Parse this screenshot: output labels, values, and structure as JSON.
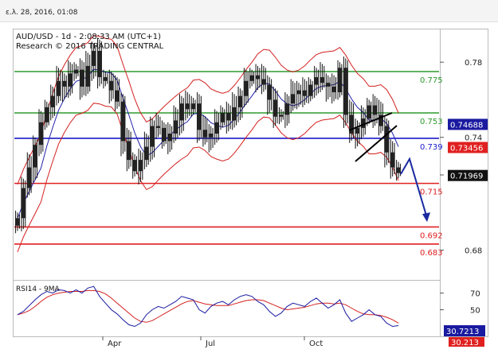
{
  "header": {
    "timestamp": "ε.λ. 28, 2016, 01:08"
  },
  "chart_data": {
    "type": "candlestick",
    "title": "AUD/USD - 1d - 2:08:33 AM (UTC+1)",
    "subtitle": "Research © 2016 TRADING CENTRAL",
    "x_labels": [
      "Apr",
      "Jul",
      "Oct"
    ],
    "y_axis": {
      "range": [
        0.665,
        0.797
      ],
      "ticks": [
        "0.78",
        "0.74",
        "0.72",
        "0.68"
      ]
    },
    "levels": [
      {
        "label": "0.775",
        "value": 0.775,
        "color": "#2f9a2f"
      },
      {
        "label": "0.753",
        "value": 0.753,
        "color": "#2f9a2f"
      },
      {
        "label": "0.739",
        "value": 0.7395,
        "color": "#1a1acc"
      },
      {
        "label": "0.715",
        "value": 0.7155,
        "color": "#e02020"
      },
      {
        "label": "0.692",
        "value": 0.6923,
        "color": "#e02020"
      },
      {
        "label": "0.683",
        "value": 0.6832,
        "color": "#e02020"
      }
    ],
    "price_boxes": [
      {
        "label": "0.74688",
        "value": 0.7469,
        "bg": "#1a1aa0"
      },
      {
        "label": "0.73456",
        "value": 0.7346,
        "bg": "#e02020"
      },
      {
        "label": "0.71969",
        "value": 0.7197,
        "bg": "#111111"
      }
    ],
    "price_series": [
      0.697,
      0.713,
      0.724,
      0.736,
      0.748,
      0.756,
      0.762,
      0.77,
      0.767,
      0.774,
      0.776,
      0.767,
      0.778,
      0.786,
      0.772,
      0.77,
      0.765,
      0.759,
      0.738,
      0.728,
      0.722,
      0.728,
      0.735,
      0.746,
      0.745,
      0.738,
      0.742,
      0.749,
      0.758,
      0.755,
      0.758,
      0.744,
      0.74,
      0.742,
      0.748,
      0.753,
      0.749,
      0.756,
      0.762,
      0.77,
      0.773,
      0.771,
      0.768,
      0.76,
      0.751,
      0.752,
      0.758,
      0.763,
      0.765,
      0.762,
      0.768,
      0.772,
      0.769,
      0.767,
      0.764,
      0.777,
      0.752,
      0.742,
      0.745,
      0.75,
      0.757,
      0.752,
      0.746,
      0.732,
      0.724,
      0.721
    ],
    "forecast": {
      "points": [
        [
          0.7205,
          0.7285
        ],
        [
          0.695
        ]
      ]
    },
    "rsi": {
      "title": "RSI14 - 9MA",
      "ticks": [
        "70",
        "50"
      ],
      "range": [
        20,
        82
      ],
      "value_label": "30.7213",
      "ma_label": "30.213",
      "series": [
        44,
        48,
        55,
        62,
        68,
        72,
        70,
        74,
        73,
        70,
        74,
        70,
        76,
        78,
        66,
        58,
        50,
        45,
        38,
        32,
        30,
        34,
        44,
        50,
        54,
        52,
        56,
        60,
        66,
        64,
        62,
        50,
        46,
        54,
        58,
        60,
        56,
        62,
        66,
        68,
        66,
        60,
        56,
        48,
        42,
        46,
        54,
        58,
        56,
        54,
        60,
        64,
        58,
        52,
        56,
        62,
        46,
        36,
        40,
        44,
        50,
        44,
        42,
        34,
        30,
        31
      ],
      "ma_series": [
        44,
        46,
        49,
        54,
        60,
        65,
        68,
        70,
        71,
        72,
        72,
        72,
        73,
        73,
        72,
        69,
        64,
        58,
        52,
        46,
        40,
        36,
        35,
        37,
        41,
        45,
        49,
        53,
        57,
        60,
        61,
        59,
        57,
        56,
        55,
        55,
        55,
        57,
        59,
        61,
        62,
        62,
        61,
        58,
        55,
        52,
        50,
        51,
        52,
        53,
        55,
        57,
        58,
        58,
        57,
        58,
        56,
        52,
        48,
        45,
        44,
        44,
        43,
        41,
        38,
        34
      ]
    }
  }
}
